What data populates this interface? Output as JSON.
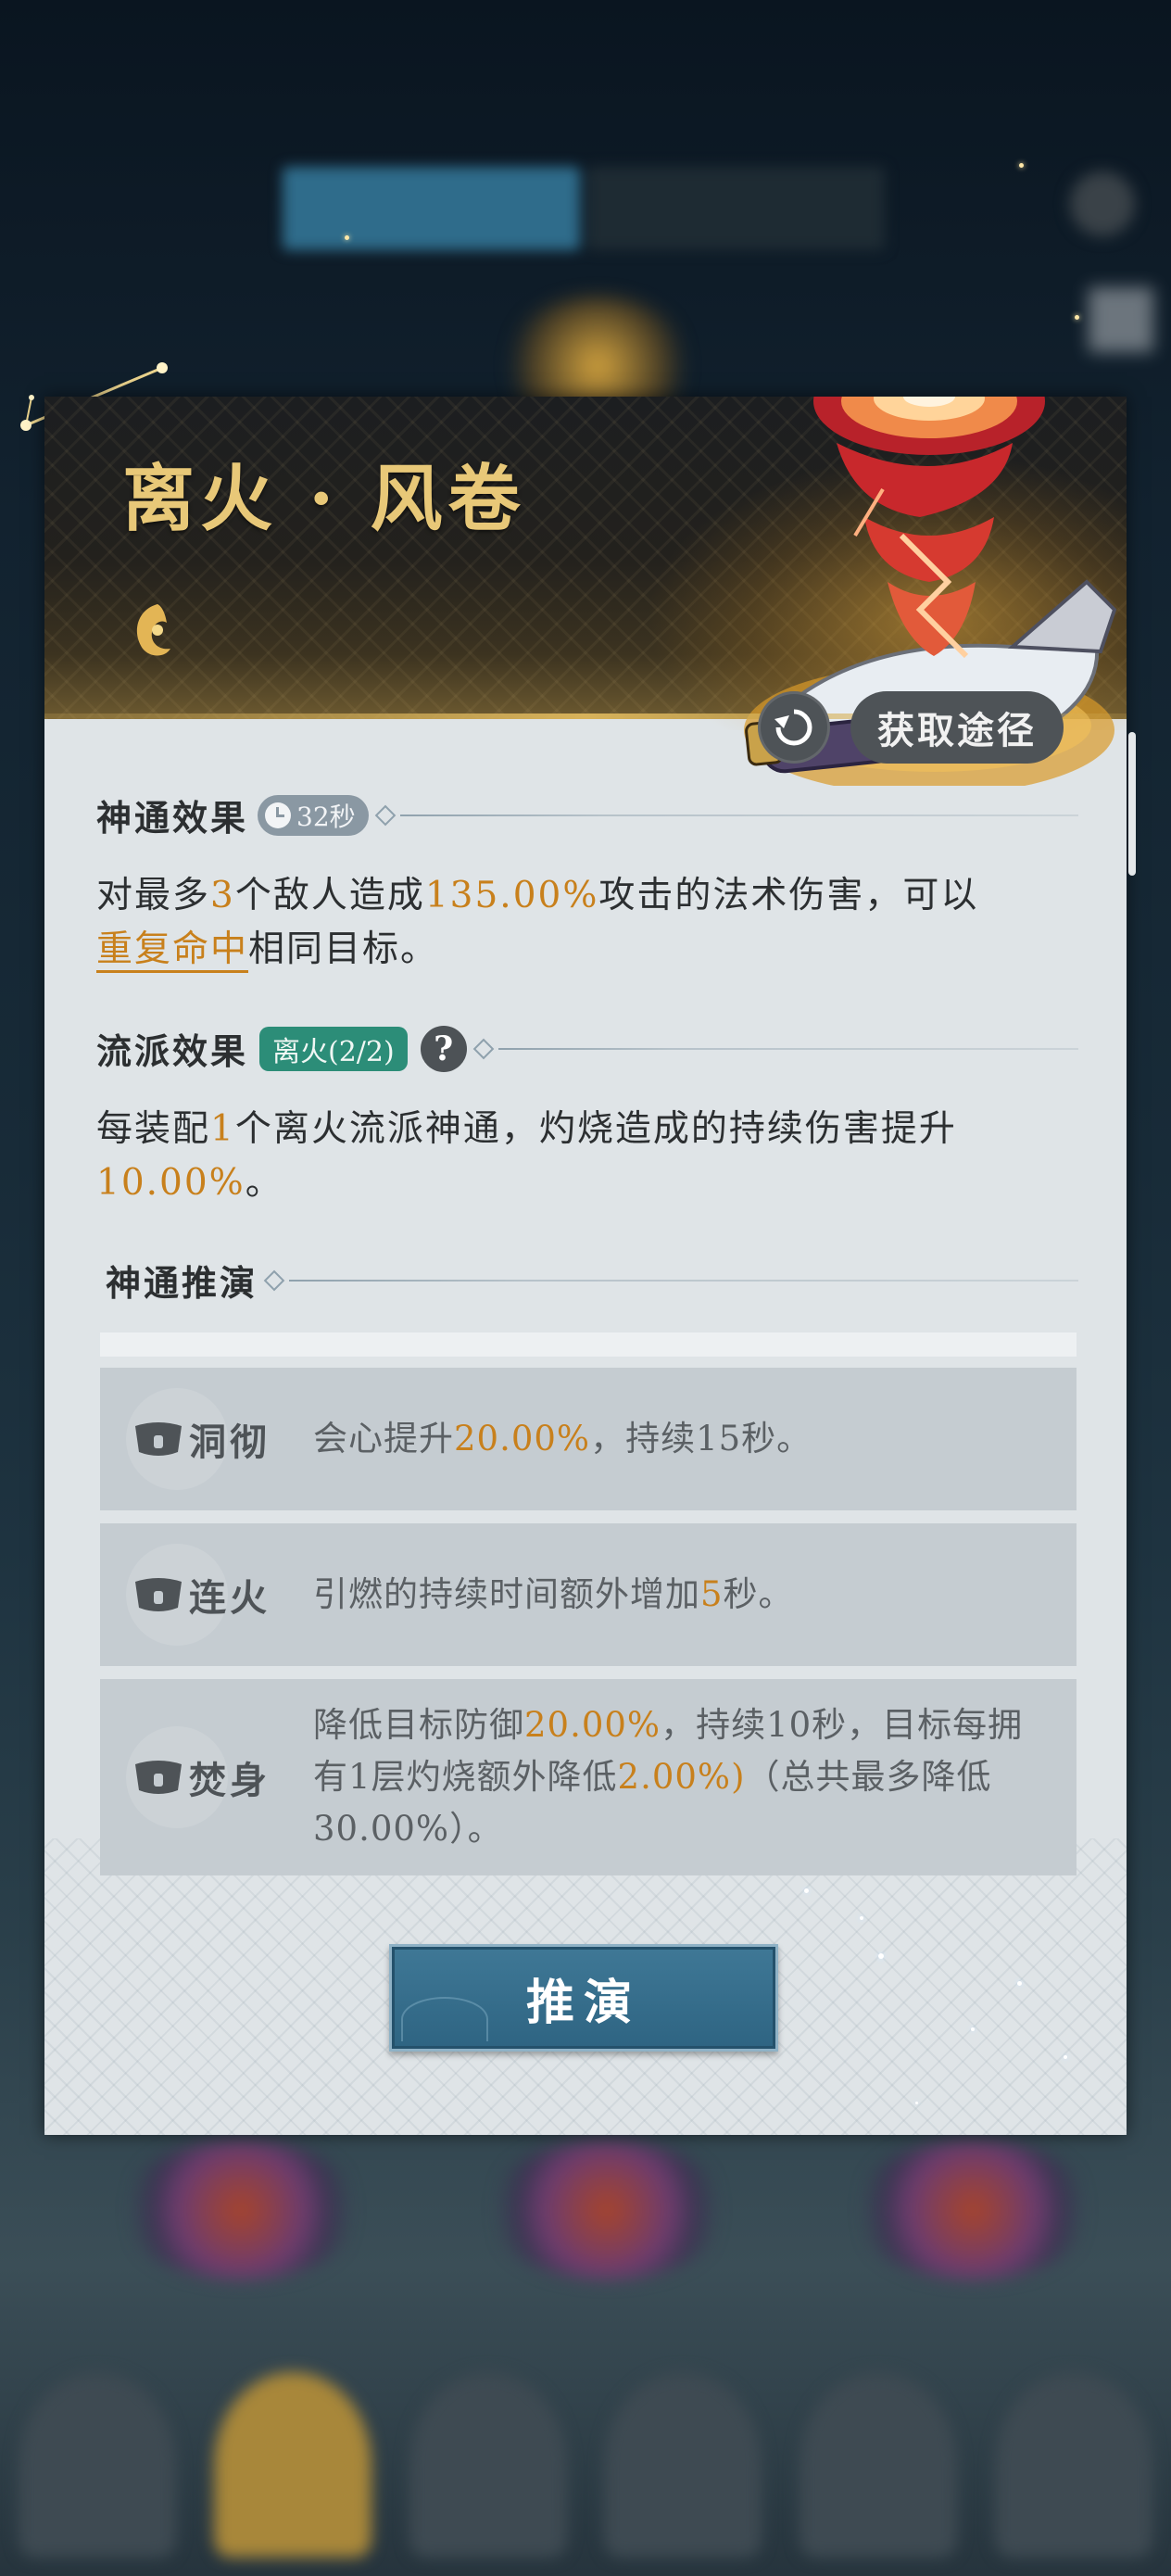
{
  "skill": {
    "name": "离火 · 风卷",
    "element_icon": "fire-crescent-icon",
    "source_label": "获取途径",
    "refresh_icon": "refresh-icon"
  },
  "effect": {
    "title": "神通效果",
    "cooldown": "32秒",
    "text_parts": [
      "对最多",
      "3",
      "个敌人造成",
      "135.00%",
      "攻击的法术伤害，可以",
      "重复命中",
      "相同目标。"
    ]
  },
  "school": {
    "title": "流派效果",
    "badge": "离火(2/2)",
    "help": "?",
    "text_parts": [
      "每装配",
      "1",
      "个离火流派神通，灼烧造成的持续伤害提升",
      "10.00%",
      "。"
    ]
  },
  "deduce": {
    "title": "神通推演",
    "button_label": "推演",
    "items": [
      {
        "name": "洞彻",
        "desc_parts": [
          "会心提升",
          "20.00%",
          "，持续15秒。"
        ]
      },
      {
        "name": "连火",
        "desc_parts": [
          "引燃的持续时间额外增加",
          "5",
          "秒。"
        ]
      },
      {
        "name": "焚身",
        "desc_parts": [
          "降低目标防御",
          "20.00%",
          "，持续10秒，目标每拥有1层灼烧额外降低",
          "2.00%)",
          "（总共最多降低30.00%）。"
        ]
      }
    ]
  },
  "colors": {
    "highlight": "#c8801c",
    "title_gold": "#e8c878",
    "school_badge": "#2c8d78",
    "button_blue": "#3a7090"
  }
}
